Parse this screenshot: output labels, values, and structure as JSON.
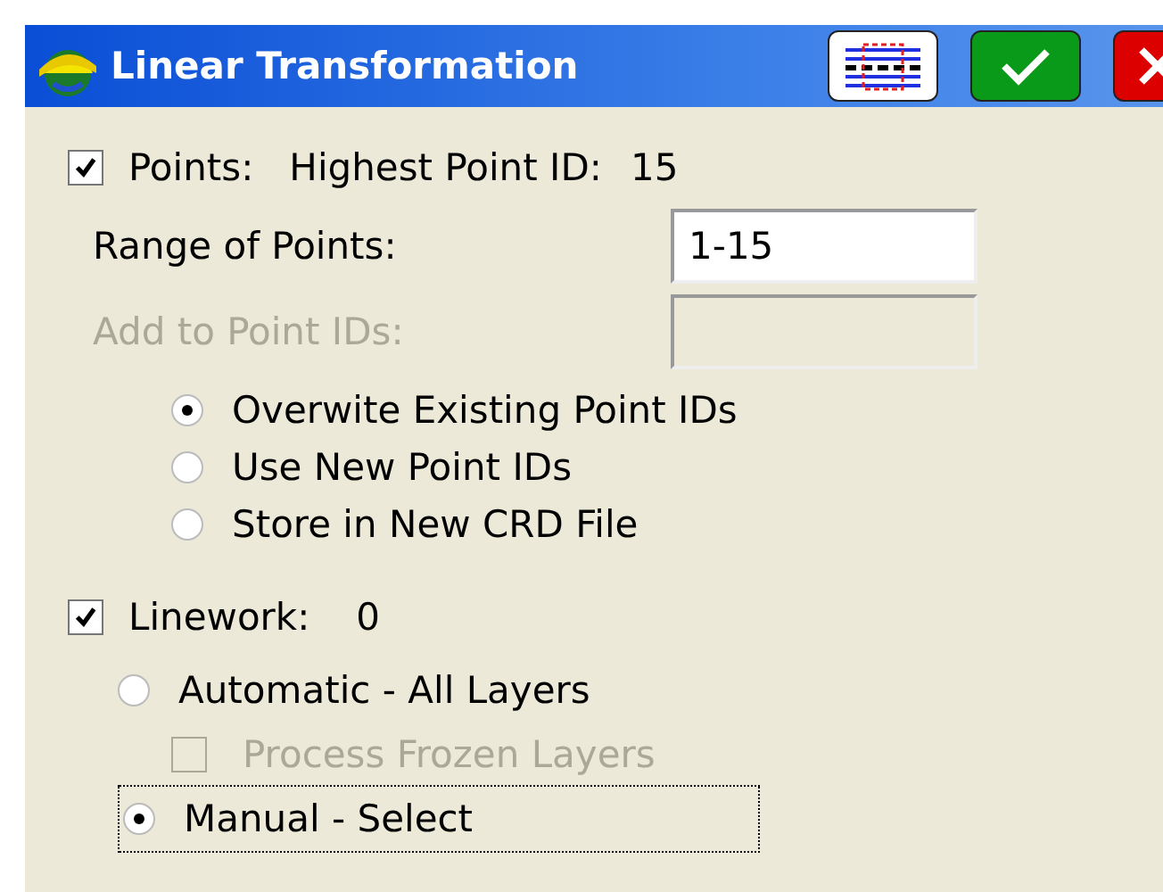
{
  "window": {
    "title": "Linear Transformation"
  },
  "points": {
    "checked": true,
    "label": "Points:",
    "highest_label": "Highest Point ID:",
    "highest_value": "15"
  },
  "range": {
    "label": "Range of Points:",
    "value": "1-15"
  },
  "add_ids": {
    "label": "Add to Point IDs:",
    "disabled": true
  },
  "point_options": [
    {
      "label": "Overwite Existing Point IDs",
      "selected": true
    },
    {
      "label": "Use New Point IDs",
      "selected": false
    },
    {
      "label": "Store in New CRD File",
      "selected": false
    }
  ],
  "linework": {
    "checked": true,
    "label": "Linework:",
    "value": "0"
  },
  "automatic": {
    "label": "Automatic - All Layers",
    "selected": false
  },
  "frozen": {
    "label": "Process Frozen Layers",
    "checked": false,
    "disabled": true
  },
  "manual": {
    "label": "Manual - Select",
    "selected": true,
    "focused": true
  }
}
